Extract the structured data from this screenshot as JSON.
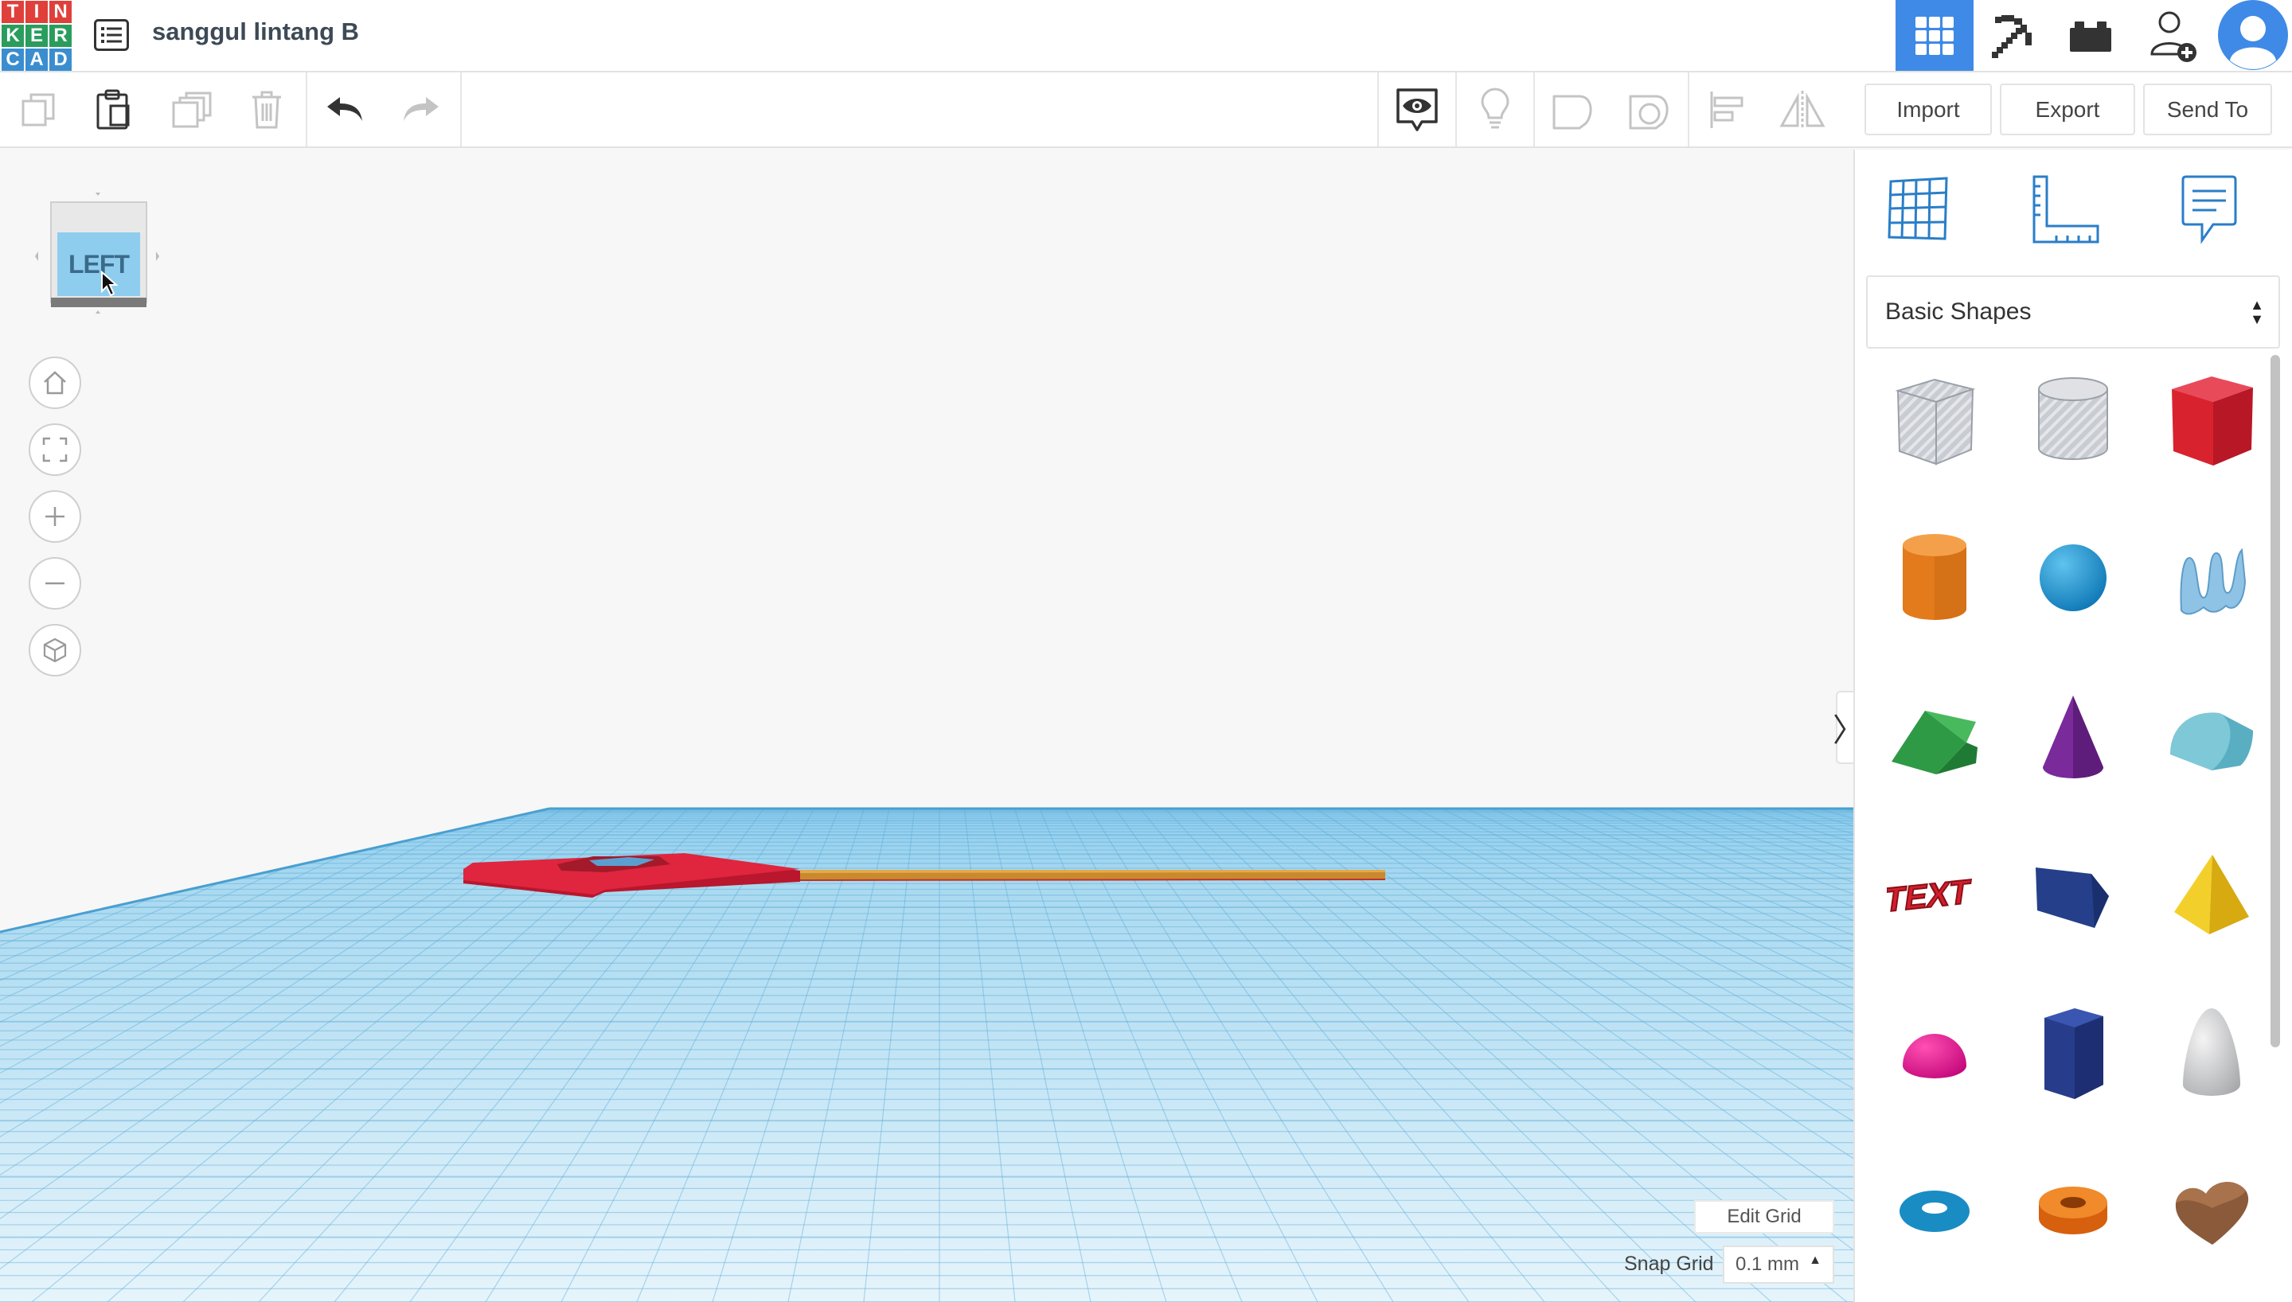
{
  "app": {
    "logo_letters": [
      "T",
      "I",
      "N",
      "K",
      "E",
      "R",
      "C",
      "A",
      "D"
    ],
    "logo_colors": [
      "#e0403a",
      "#e0403a",
      "#e0403a",
      "#2a9d5d",
      "#2a9d5d",
      "#2a9d5d",
      "#3a8ed0",
      "#3a8ed0",
      "#3a8ed0"
    ],
    "design_title": "sanggul lintang B",
    "accent_color": "#3f8ae6"
  },
  "toolbar": {
    "import_label": "Import",
    "export_label": "Export",
    "send_to_label": "Send To"
  },
  "viewcube": {
    "face_label": "LEFT"
  },
  "panel": {
    "shape_library": "Basic Shapes",
    "shapes": [
      {
        "name": "Box (Hole)",
        "icon": "box-hole-icon"
      },
      {
        "name": "Cylinder (Hole)",
        "icon": "cylinder-hole-icon"
      },
      {
        "name": "Box",
        "icon": "box-icon"
      },
      {
        "name": "Cylinder",
        "icon": "cylinder-icon"
      },
      {
        "name": "Sphere",
        "icon": "sphere-icon"
      },
      {
        "name": "Scribble",
        "icon": "scribble-icon"
      },
      {
        "name": "Roof",
        "icon": "roof-icon"
      },
      {
        "name": "Cone",
        "icon": "cone-icon"
      },
      {
        "name": "Round Roof",
        "icon": "round-roof-icon"
      },
      {
        "name": "Text",
        "icon": "text-icon",
        "text": "TEXT"
      },
      {
        "name": "Wedge",
        "icon": "wedge-icon"
      },
      {
        "name": "Pyramid",
        "icon": "pyramid-icon"
      },
      {
        "name": "Half Sphere",
        "icon": "half-sphere-icon"
      },
      {
        "name": "Polygon",
        "icon": "polygon-icon"
      },
      {
        "name": "Paraboloid",
        "icon": "paraboloid-icon"
      },
      {
        "name": "Torus",
        "icon": "torus-icon"
      },
      {
        "name": "Tube",
        "icon": "tube-icon"
      },
      {
        "name": "Heart",
        "icon": "heart-icon"
      }
    ]
  },
  "grid": {
    "edit_grid_label": "Edit Grid",
    "snap_grid_label": "Snap Grid",
    "snap_grid_value": "0.1 mm"
  }
}
